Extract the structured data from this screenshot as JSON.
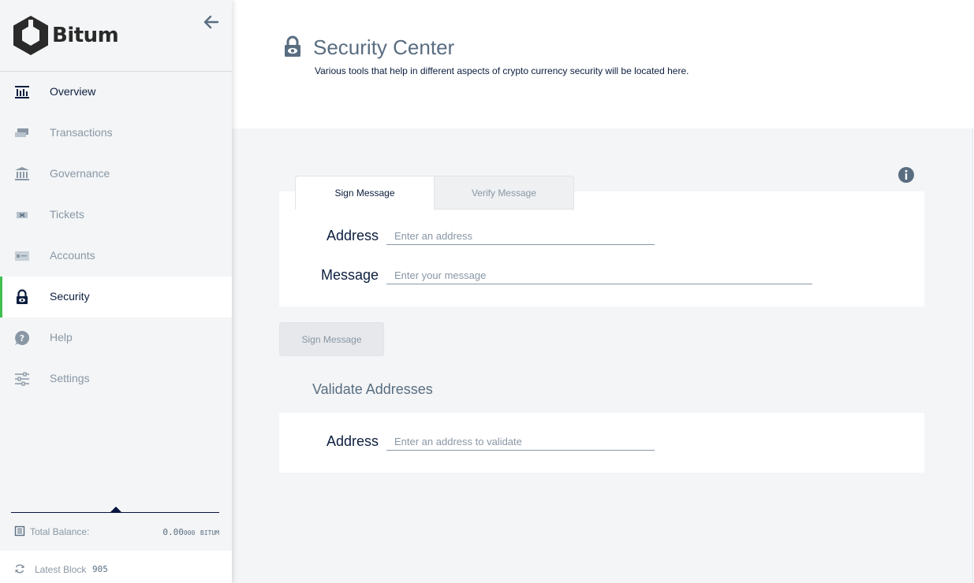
{
  "app": {
    "brand_name": "Bitum"
  },
  "sidebar": {
    "items": [
      {
        "label": "Overview",
        "icon": "overview-icon"
      },
      {
        "label": "Transactions",
        "icon": "transactions-icon"
      },
      {
        "label": "Governance",
        "icon": "governance-icon"
      },
      {
        "label": "Tickets",
        "icon": "tickets-icon"
      },
      {
        "label": "Accounts",
        "icon": "accounts-icon"
      },
      {
        "label": "Security",
        "icon": "lock-icon",
        "active": true
      },
      {
        "label": "Help",
        "icon": "help-icon"
      },
      {
        "label": "Settings",
        "icon": "settings-icon"
      }
    ],
    "total_balance": {
      "label": "Total Balance:",
      "value_main": "0.00",
      "value_small": "000",
      "unit": "BITUM"
    },
    "latest_block": {
      "label": "Latest Block",
      "value": "905"
    }
  },
  "header": {
    "title": "Security Center",
    "description": "Various tools that help in different aspects of crypto currency security will be located here."
  },
  "tabs": [
    {
      "label": "Sign Message",
      "active": true
    },
    {
      "label": "Verify Message",
      "active": false
    }
  ],
  "sign_form": {
    "address_label": "Address",
    "address_placeholder": "Enter an address",
    "message_label": "Message",
    "message_placeholder": "Enter your message",
    "button_label": "Sign Message"
  },
  "validate": {
    "title": "Validate Addresses",
    "address_label": "Address",
    "address_placeholder": "Enter an address to validate"
  },
  "colors": {
    "accent_green": "#41bf53",
    "text_dark": "#0c1e3e",
    "text_muted": "#8997a5",
    "bg_gray": "#f3f5f6"
  }
}
